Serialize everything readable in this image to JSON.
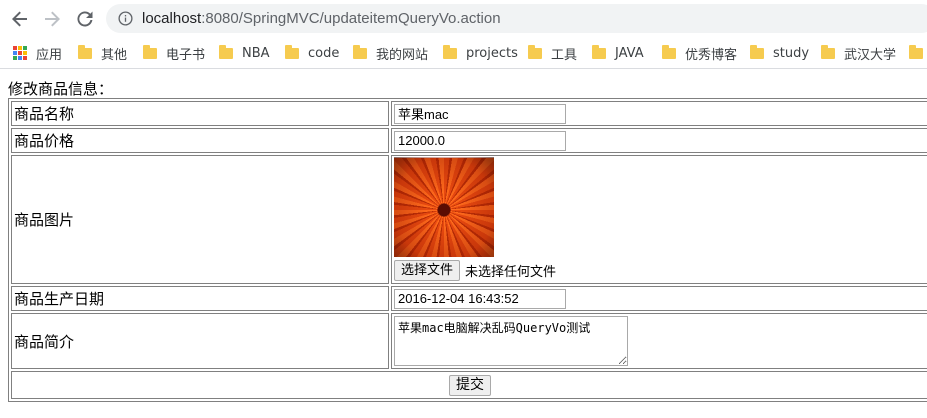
{
  "browser": {
    "url_host": "localhost",
    "url_path": ":8080/SpringMVC/updateitemQueryVo.action",
    "bookmarks": [
      {
        "label": "应用",
        "icon": "apps-grid-icon"
      },
      {
        "label": "其他",
        "icon": "folder-icon"
      },
      {
        "label": "电子书",
        "icon": "folder-icon"
      },
      {
        "label": "NBA",
        "icon": "folder-icon"
      },
      {
        "label": "code",
        "icon": "folder-icon"
      },
      {
        "label": "我的网站",
        "icon": "folder-icon"
      },
      {
        "label": "projects",
        "icon": "folder-icon"
      },
      {
        "label": "工具",
        "icon": "folder-icon"
      },
      {
        "label": "JAVA",
        "icon": "folder-icon"
      },
      {
        "label": "优秀博客",
        "icon": "folder-icon"
      },
      {
        "label": "study",
        "icon": "folder-icon"
      },
      {
        "label": "武汉大学",
        "icon": "folder-icon"
      }
    ]
  },
  "form": {
    "caption": "修改商品信息：",
    "rows": {
      "name": {
        "label": "商品名称",
        "value": "苹果mac"
      },
      "price": {
        "label": "商品价格",
        "value": "12000.0"
      },
      "image": {
        "label": "商品图片",
        "choose_button": "选择文件",
        "file_status": "未选择任何文件"
      },
      "date": {
        "label": "商品生产日期",
        "value": "2016-12-04 16:43:52"
      },
      "detail": {
        "label": "商品简介",
        "value": "苹果mac电脑解决乱码QueryVo测试"
      }
    },
    "submit_label": "提交"
  },
  "colors": {
    "folder": "#f6cb4f",
    "omnibox_bg": "#f1f3f4",
    "border": "#808080"
  }
}
